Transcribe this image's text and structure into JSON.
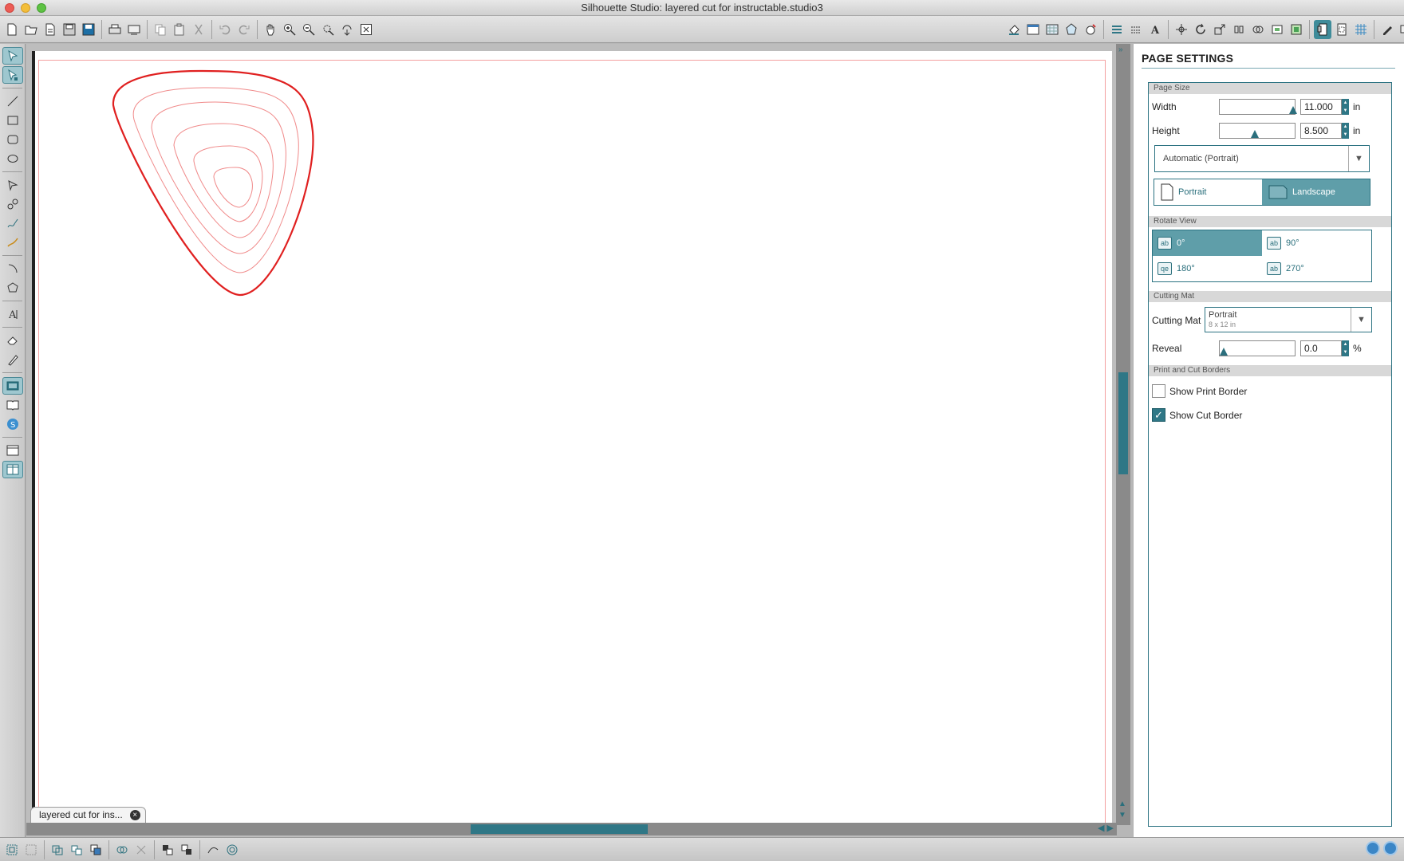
{
  "window": {
    "title": "Silhouette Studio: layered cut for instructable.studio3"
  },
  "colors": {
    "accent": "#2f7786",
    "cut_line": "#e02020",
    "border_line": "#f4a0a0"
  },
  "toolbar": {
    "left_icons": [
      "new-doc-icon",
      "open-icon",
      "open-recent-icon",
      "save-icon",
      "save-as-icon",
      "print-icon",
      "send-icon",
      "copy-icon",
      "paste-icon",
      "cut-icon",
      "undo-icon",
      "redo-icon",
      "pan-icon",
      "zoom-in-icon",
      "zoom-out-icon",
      "zoom-select-icon",
      "zoom-drag-icon",
      "zoom-fit-icon"
    ],
    "right_icons": [
      "fill-icon",
      "line-color-icon",
      "gradient-icon",
      "pattern-icon",
      "line-style-icon",
      "align-icon",
      "replicate-icon",
      "text-style-icon",
      "transform-icon",
      "rotate-icon",
      "scale-icon",
      "move-icon",
      "modify-icon",
      "offset-icon",
      "trace-icon",
      "cut-settings-icon",
      "page-settings-icon",
      "registration-icon",
      "grid-icon",
      "design-store-icon",
      "send-to-silhouette-icon"
    ]
  },
  "left_tools": [
    "select-icon",
    "point-edit-icon",
    "line-icon",
    "rectangle-icon",
    "rounded-rect-icon",
    "ellipse-icon",
    "polygon-icon",
    "curve-icon",
    "freehand-icon",
    "smooth-freehand-icon",
    "arc-icon",
    "regular-polygon-icon",
    "text-icon",
    "eraser-icon",
    "knife-icon",
    "draw-screen-icon",
    "library-icon",
    "store-icon",
    "single-view-icon",
    "split-view-icon"
  ],
  "document_tab": {
    "label": "layered cut for ins...",
    "close": "×"
  },
  "panel": {
    "title": "PAGE SETTINGS",
    "page_size": {
      "header": "Page Size",
      "width_label": "Width",
      "width_value": "11.000",
      "width_unit": "in",
      "height_label": "Height",
      "height_value": "8.500",
      "height_unit": "in",
      "preset": "Automatic (Portrait)",
      "portrait_label": "Portrait",
      "landscape_label": "Landscape"
    },
    "rotate_view": {
      "header": "Rotate View",
      "options": [
        "0°",
        "90°",
        "180°",
        "270°"
      ],
      "selected": "0°"
    },
    "cutting_mat": {
      "header": "Cutting Mat",
      "label": "Cutting Mat",
      "value": "Portrait",
      "subvalue": "8 x 12 in",
      "reveal_label": "Reveal",
      "reveal_value": "0.0",
      "reveal_unit": "%"
    },
    "borders": {
      "header": "Print and Cut Borders",
      "show_print_border": "Show Print Border",
      "show_print_border_checked": false,
      "show_cut_border": "Show Cut Border",
      "show_cut_border_checked": true
    }
  }
}
